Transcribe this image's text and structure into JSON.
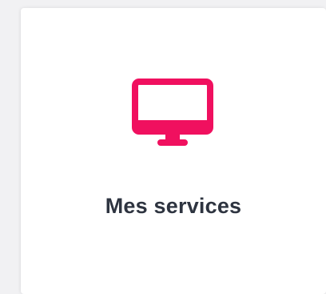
{
  "card": {
    "title": "Mes services",
    "icon": "monitor-icon",
    "accent_color": "#f0105f"
  }
}
